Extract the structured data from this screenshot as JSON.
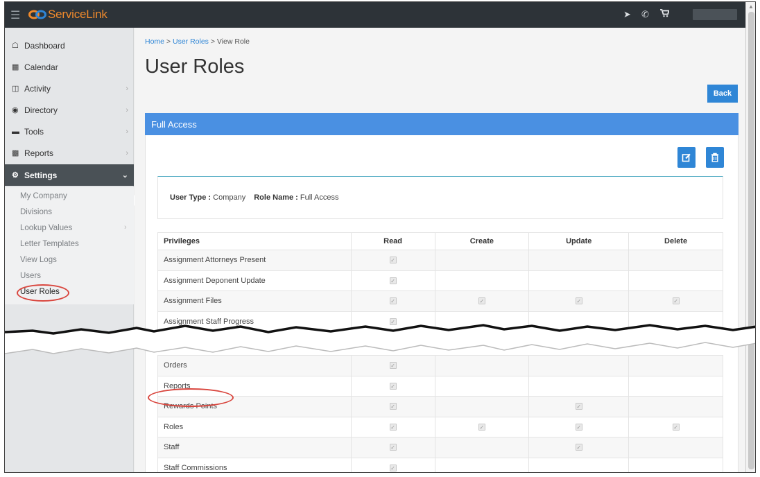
{
  "app": {
    "name": "ServiceLink"
  },
  "topbar": {
    "icons": [
      "hamburger-icon",
      "location-arrow-icon",
      "phone-icon",
      "cart-icon"
    ]
  },
  "sidebar": {
    "items": [
      {
        "label": "Dashboard",
        "icon": "home-icon",
        "chevron": false
      },
      {
        "label": "Calendar",
        "icon": "calendar-icon",
        "chevron": false
      },
      {
        "label": "Activity",
        "icon": "files-icon",
        "chevron": true
      },
      {
        "label": "Directory",
        "icon": "users-icon",
        "chevron": true
      },
      {
        "label": "Tools",
        "icon": "toolbox-icon",
        "chevron": true
      },
      {
        "label": "Reports",
        "icon": "bar-chart-icon",
        "chevron": true
      },
      {
        "label": "Settings",
        "icon": "gear-icon",
        "chevron": true,
        "active": true
      }
    ],
    "submenu": [
      {
        "label": "My Company"
      },
      {
        "label": "Divisions"
      },
      {
        "label": "Lookup Values",
        "chevron": true
      },
      {
        "label": "Letter Templates"
      },
      {
        "label": "View Logs"
      },
      {
        "label": "Users"
      },
      {
        "label": "User Roles",
        "current": true
      }
    ]
  },
  "breadcrumb": {
    "home": "Home",
    "sep": " > ",
    "roles": "User Roles",
    "current": "View Role"
  },
  "page": {
    "title": "User Roles",
    "back_label": "Back"
  },
  "panel": {
    "title": "Full Access",
    "user_type_label": "User Type :",
    "user_type_value": "Company",
    "role_name_label": "Role Name :",
    "role_name_value": "Full Access"
  },
  "table": {
    "headers": [
      "Privileges",
      "Read",
      "Create",
      "Update",
      "Delete"
    ],
    "rows_top": [
      {
        "name": "Assignment Attorneys Present",
        "perms": [
          true,
          false,
          false,
          false
        ]
      },
      {
        "name": "Assignment Deponent Update",
        "perms": [
          true,
          false,
          false,
          false
        ]
      },
      {
        "name": "Assignment Files",
        "perms": [
          true,
          true,
          true,
          true
        ]
      },
      {
        "name": "Assignment Staff Progress",
        "perms": [
          true,
          false,
          false,
          false
        ]
      }
    ],
    "rows_bottom": [
      {
        "name": "Orders",
        "perms": [
          true,
          false,
          false,
          false
        ]
      },
      {
        "name": "Reports",
        "perms": [
          true,
          false,
          false,
          false
        ]
      },
      {
        "name": "Rewards Points",
        "perms": [
          true,
          false,
          true,
          false
        ]
      },
      {
        "name": "Roles",
        "perms": [
          true,
          true,
          true,
          true
        ]
      },
      {
        "name": "Staff",
        "perms": [
          true,
          false,
          true,
          false
        ]
      },
      {
        "name": "Staff Commissions",
        "perms": [
          true,
          false,
          false,
          false
        ]
      }
    ]
  },
  "colors": {
    "accent": "#2f86d6",
    "panel_header": "#4a90e2",
    "annotation": "#d9463e",
    "brand": "#f08a2c"
  }
}
